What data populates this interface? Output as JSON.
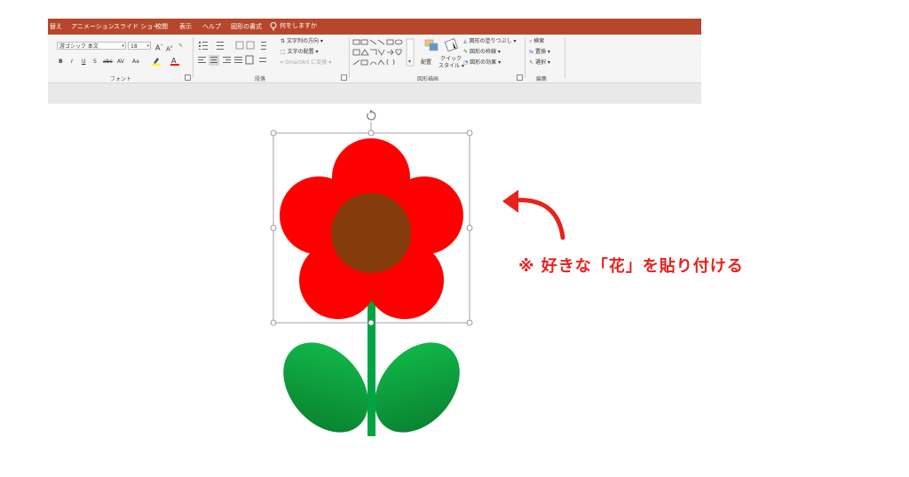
{
  "tabs": [
    {
      "label": "替え"
    },
    {
      "label": "アニメーション"
    },
    {
      "label": "スライド ショー"
    },
    {
      "label": "校閲"
    },
    {
      "label": "表示"
    },
    {
      "label": "ヘルプ"
    },
    {
      "label": "図形の書式"
    }
  ],
  "tell_me": "何をしますか",
  "font_group": {
    "font_name": "游ゴシック 本文",
    "font_size": "18",
    "grow": "A",
    "shrink": "A",
    "bold": "B",
    "italic": "I",
    "underline": "U",
    "shadow": "S",
    "strike": "abc",
    "spacing": "AV",
    "case": "Aa",
    "label": "フォント"
  },
  "paragraph_group": {
    "text_direction": "文字列の方向",
    "align_text": "文字の配置",
    "smartart": "SmartArt に変換",
    "label": "段落"
  },
  "drawing_group": {
    "arrange": "配置",
    "quick_styles_1": "クイック",
    "quick_styles_2": "スタイル",
    "fill": "図形の塗りつぶし",
    "outline": "図形の枠線",
    "effects": "図形の効果",
    "label": "図形描画"
  },
  "editing_group": {
    "find": "検索",
    "replace": "置換",
    "select": "選択",
    "label": "編集"
  },
  "callout": "※ 好きな「花」を貼り付ける",
  "colors": {
    "ribbon_accent": "#b7472a",
    "petal": "#ff0000",
    "center": "#843c0c",
    "stem": "#00a543",
    "leaf_light": "#12c04e",
    "leaf_dark": "#097a2c",
    "callout": "#e8221c",
    "arrow": "#e8221c"
  }
}
